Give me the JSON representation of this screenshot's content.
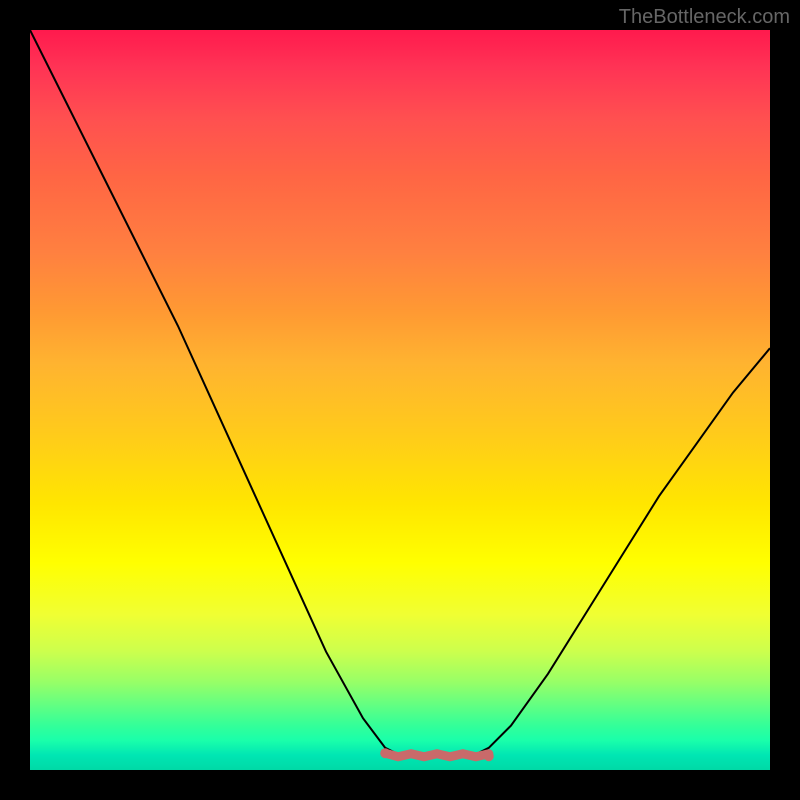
{
  "watermark": "TheBottleneck.com",
  "chart_data": {
    "type": "line",
    "title": "",
    "xlabel": "",
    "ylabel": "",
    "x": [
      0.0,
      0.05,
      0.1,
      0.15,
      0.2,
      0.25,
      0.3,
      0.35,
      0.4,
      0.45,
      0.48,
      0.5,
      0.52,
      0.55,
      0.58,
      0.6,
      0.62,
      0.65,
      0.7,
      0.75,
      0.8,
      0.85,
      0.9,
      0.95,
      1.0
    ],
    "values": [
      1.0,
      0.9,
      0.8,
      0.7,
      0.6,
      0.49,
      0.38,
      0.27,
      0.16,
      0.07,
      0.03,
      0.02,
      0.02,
      0.02,
      0.02,
      0.02,
      0.03,
      0.06,
      0.13,
      0.21,
      0.29,
      0.37,
      0.44,
      0.51,
      0.57
    ],
    "flat_segment": {
      "x_start": 0.48,
      "x_end": 0.62,
      "y": 0.02,
      "color": "#c96a6a"
    },
    "xlim": [
      0,
      1
    ],
    "ylim": [
      0,
      1
    ],
    "background": "gradient-vertical",
    "gradient_colors": [
      "#ff1a4d",
      "#ff8040",
      "#ffe600",
      "#00d9a6"
    ]
  }
}
